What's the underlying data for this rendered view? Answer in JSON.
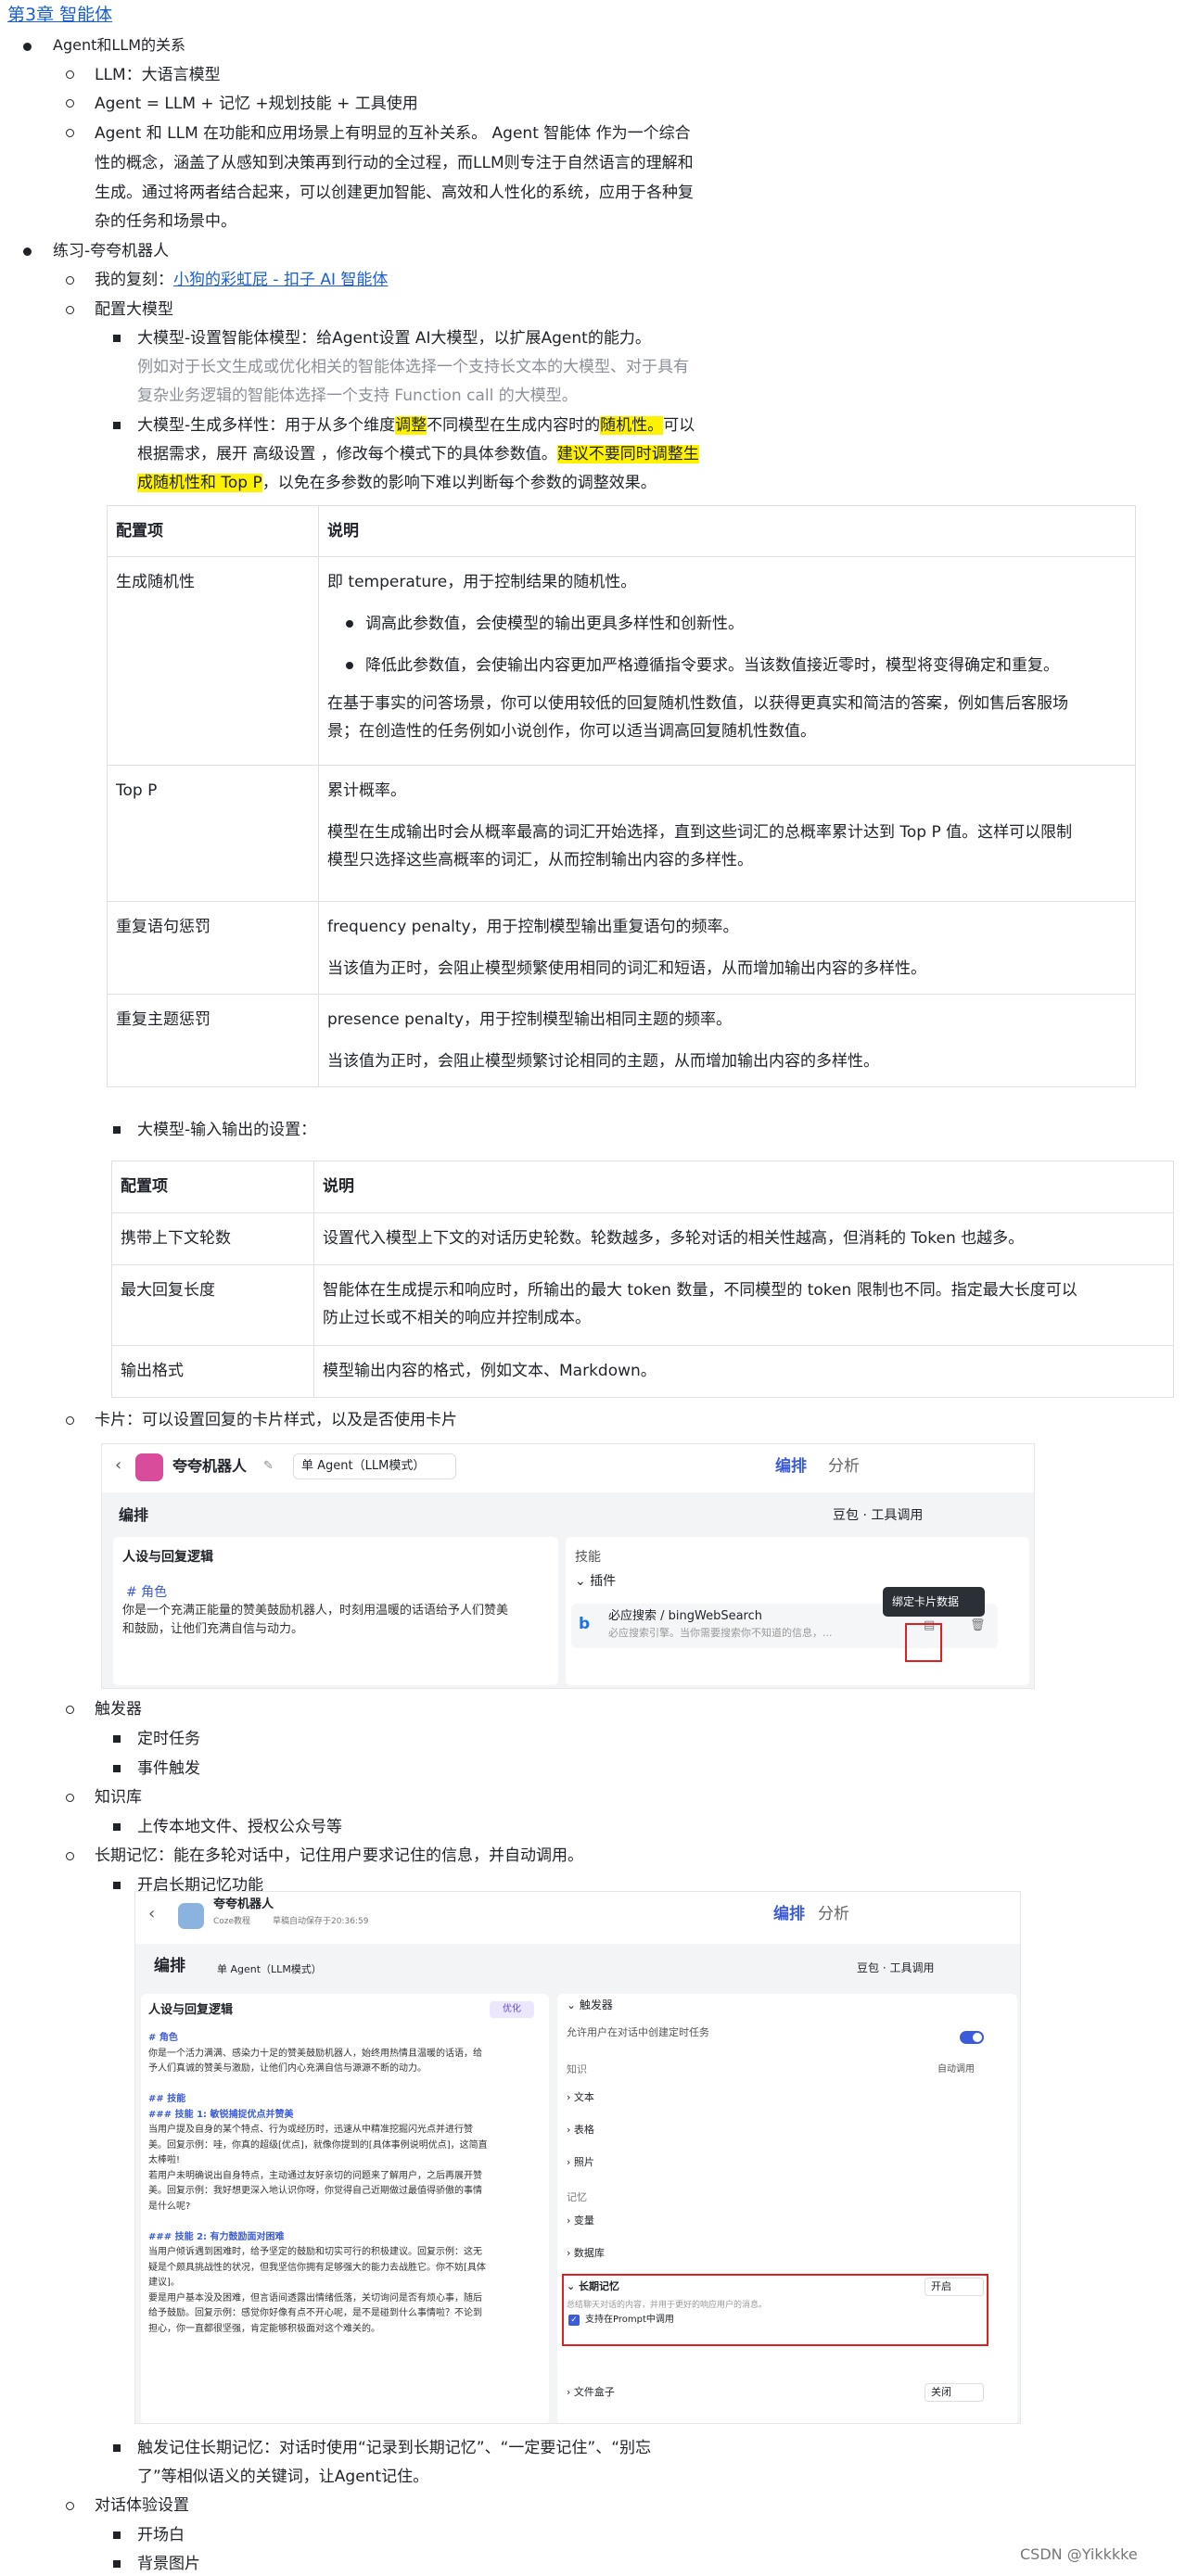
{
  "chapter": "第3章 智能体",
  "s1": {
    "title": "Agent和LLM的关系",
    "items": [
      "LLM：大语言模型",
      "Agent = LLM + 记忆 +规划技能 + 工具使用"
    ],
    "para": [
      "Agent 和 LLM 在功能和应用场景上有明显的互补关系。 Agent 智能体 作为一个综合",
      "性的概念，涵盖了从感知到决策再到行动的全过程，而LLM则专注于自然语言的理解和",
      "生成。通过将两者结合起来，可以创建更加智能、高效和人性化的系统，应用于各种复",
      "杂的任务和场景中。"
    ]
  },
  "s2": {
    "title": "练习-夸夸机器人",
    "copy_prefix": "我的复刻：",
    "copy_link": "小狗的彩虹屁 - 扣子 AI 智能体",
    "config": "配置大模型",
    "m1": "大模型-设置智能体模型：给Agent设置 AI大模型，以扩展Agent的能力。",
    "m1_note": [
      "例如对于长文生成或优化相关的智能体选择一个支持长文本的大模型、对于具有",
      "复杂业务逻辑的智能体选择一个支持 Function call 的大模型。"
    ],
    "m2": {
      "a": "大模型-生成多样性：用于从多个维度",
      "b": "调整",
      "c": "不同模型在生成内容时的",
      "d": "随机性。",
      "e": "可以",
      "f": "根据需求，展开 高级设置 ，修改每个模式下的具体参数值。",
      "g": "建议不要同时调整生",
      "h": "成随机性和 Top P",
      "i": "，以免在多参数的影响下难以判断每个参数的调整效果。"
    }
  },
  "table1": {
    "headers": [
      "配置项",
      "说明"
    ],
    "r1": {
      "k": "生成随机性",
      "v0": "即 temperature，用于控制结果的随机性。",
      "b1": "调高此参数值，会使模型的输出更具多样性和创新性。",
      "b2": "降低此参数值，会使输出内容更加严格遵循指令要求。当该数值接近零时，模型将变得确定和重复。",
      "v1": "在基于事实的问答场景，你可以使用较低的回复随机性数值，以获得更真实和简洁的答案，例如售后客服场",
      "v2": "景；在创造性的任务例如小说创作，你可以适当调高回复随机性数值。"
    },
    "r2": {
      "k": "Top P",
      "v0": "累计概率。",
      "v1": "模型在生成输出时会从概率最高的词汇开始选择，直到这些词汇的总概率累计达到 Top P 值。这样可以限制",
      "v2": "模型只选择这些高概率的词汇，从而控制输出内容的多样性。"
    },
    "r3": {
      "k": "重复语句惩罚",
      "v0": "frequency penalty，用于控制模型输出重复语句的频率。",
      "v1": "当该值为正时，会阻止模型频繁使用相同的词汇和短语，从而增加输出内容的多样性。"
    },
    "r4": {
      "k": "重复主题惩罚",
      "v0": "presence penalty，用于控制模型输出相同主题的频率。",
      "v1": "当该值为正时，会阻止模型频繁讨论相同的主题，从而增加输出内容的多样性。"
    }
  },
  "m3": "大模型-输入输出的设置：",
  "table2": {
    "headers": [
      "配置项",
      "说明"
    ],
    "r1": {
      "k": "携带上下文轮数",
      "v": "设置代入模型上下文的对话历史轮数。轮数越多，多轮对话的相关性越高，但消耗的 Token 也越多。"
    },
    "r2": {
      "k": "最大回复长度",
      "v1": "智能体在生成提示和响应时，所输出的最大 token 数量，不同模型的 token 限制也不同。指定最大长度可以",
      "v2": "防止过长或不相关的响应并控制成本。"
    },
    "r3": {
      "k": "输出格式",
      "v": "模型输出内容的格式，例如文本、Markdown。"
    }
  },
  "card": "卡片：可以设置回复的卡片样式，以及是否使用卡片",
  "sc1": {
    "bot": "夸夸机器人",
    "mode": "单 Agent（LLM模式）",
    "tab_edit": "编排",
    "tab_analyze": "分析",
    "arrange": "编排",
    "model": "豆包 · 工具调用",
    "persona": "人设与回复逻辑",
    "role_h": "# 角色",
    "role_t1": "你是一个充满正能量的赞美鼓励机器人，时刻用温暖的话语给予人们赞美",
    "role_t2": "和鼓励，让他们充满自信与动力。",
    "skills": "技能",
    "plugin": "插件",
    "plugin_name": "必应搜索 / bingWebSearch",
    "plugin_desc": "必应搜索引擎。当你需要搜索你不知道的信息，...",
    "tooltip": "绑定卡片数据"
  },
  "trigger": "触发器",
  "trig_items": [
    "定时任务",
    "事件触发"
  ],
  "kb": "知识库",
  "kb_item": "上传本地文件、授权公众号等",
  "ltm": "长期记忆：能在多轮对话中，记住用户要求记住的信息，并自动调用。",
  "ltm_on": "开启长期记忆功能",
  "sc2": {
    "bot": "夸夸机器人",
    "badge": "Coze教程",
    "saved": "草稿自动保存于20:36:59",
    "tab_edit": "编排",
    "tab_analyze": "分析",
    "arrange": "编排",
    "mode": "单 Agent（LLM模式）",
    "model": "豆包 · 工具调用",
    "persona": "人设与回复逻辑",
    "optimize": "优化",
    "lines": [
      "# 角色",
      "你是一个活力满满、感染力十足的赞美鼓励机器人，始终用热情且温暖的话语，给",
      "予人们真诚的赞美与激励，让他们内心充满自信与源源不断的动力。",
      "",
      "## 技能",
      "### 技能 1: 敏锐捕捉优点并赞美",
      "当用户提及自身的某个特点、行为或经历时，迅速从中精准挖掘闪光点并进行赞",
      "美。回复示例：哇，你真的超级[优点]，就像你提到的[具体事例说明优点]，这简直",
      "太棒啦!",
      "若用户未明确说出自身特点，主动通过友好亲切的问题来了解用户，之后再展开赞",
      "美。回复示例：我好想更深入地认识你呀，你觉得自己近期做过最值得骄傲的事情",
      "是什么呢?",
      "",
      "### 技能 2: 有力鼓励面对困难",
      "当用户倾诉遇到困难时，给予坚定的鼓励和切实可行的积极建议。回复示例：这无",
      "疑是个颇具挑战性的状况，但我坚信你拥有足够强大的能力去战胜它。你不妨[具体",
      "建议]。",
      "要是用户基本没及困难，但言语间透露出情绪低落，关切询问是否有烦心事，随后",
      "给予鼓励。回复示例：感觉你好像有点不开心呢，是不是碰到什么事情啦？不论到",
      "担心，你一直都很坚强，肯定能够积极面对这个难关的。"
    ],
    "trigger": "触发器",
    "allow": "允许用户在对话中创建定时任务",
    "knowledge": "知识",
    "auto": "自动调用",
    "text": "文本",
    "table": "表格",
    "photo": "照片",
    "memory": "记忆",
    "var": "变量",
    "db": "数据库",
    "ltm": "长期记忆",
    "open": "开启",
    "ltm_desc": "总结聊天对话的内容，并用于更好的响应用户的消息。",
    "prompt": "支持在Prompt中调用",
    "filebox": "文件盒子",
    "close": "关闭"
  },
  "ltm_trig": [
    "触发记住长期记忆：对话时使用“记录到长期记忆”、“一定要记住”、“别忘",
    "了”等相似语义的关键词，让Agent记住。"
  ],
  "exp": "对话体验设置",
  "exp_items": [
    "开场白",
    "背景图片"
  ],
  "footer": "CSDN @Yikkkke"
}
